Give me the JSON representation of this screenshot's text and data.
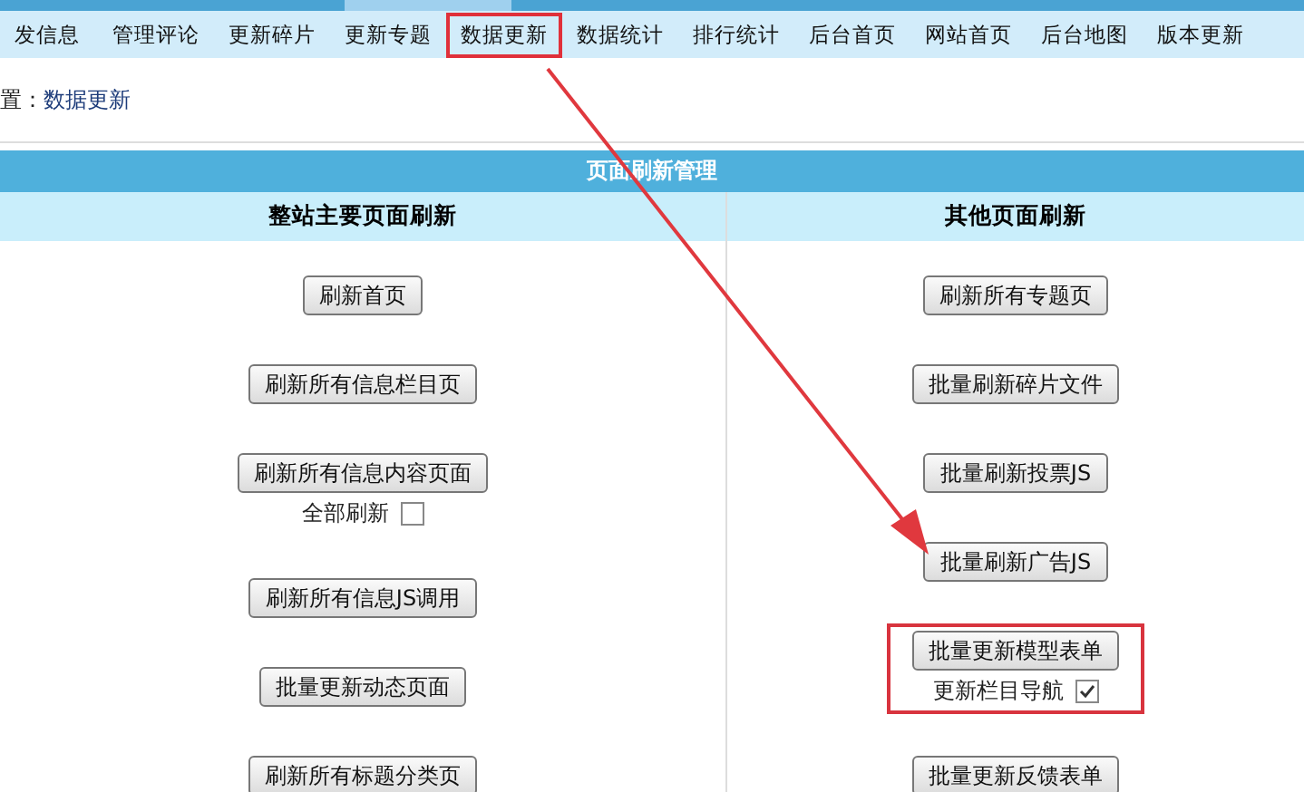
{
  "nav": [
    {
      "label": "发信息",
      "selected": false
    },
    {
      "label": "管理评论",
      "selected": false
    },
    {
      "label": "更新碎片",
      "selected": false
    },
    {
      "label": "更新专题",
      "selected": false
    },
    {
      "label": "数据更新",
      "selected": true
    },
    {
      "label": "数据统计",
      "selected": false
    },
    {
      "label": "排行统计",
      "selected": false
    },
    {
      "label": "后台首页",
      "selected": false
    },
    {
      "label": "网站首页",
      "selected": false
    },
    {
      "label": "后台地图",
      "selected": false
    },
    {
      "label": "版本更新",
      "selected": false
    }
  ],
  "breadcrumb": {
    "prefix": "置：",
    "link": "数据更新"
  },
  "panel": {
    "title": "页面刷新管理",
    "columns": [
      {
        "heading": "整站主要页面刷新",
        "items": [
          {
            "button": "刷新首页",
            "highlighted": false
          },
          {
            "button": "刷新所有信息栏目页",
            "highlighted": false
          },
          {
            "button": "刷新所有信息内容页面",
            "highlighted": false,
            "option": {
              "label": "全部刷新",
              "checked": false
            }
          },
          {
            "button": "刷新所有信息JS调用",
            "highlighted": false
          },
          {
            "button": "批量更新动态页面",
            "highlighted": false
          },
          {
            "button": "刷新所有标题分类页",
            "highlighted": false
          }
        ]
      },
      {
        "heading": "其他页面刷新",
        "items": [
          {
            "button": "刷新所有专题页",
            "highlighted": false
          },
          {
            "button": "批量刷新碎片文件",
            "highlighted": false
          },
          {
            "button": "批量刷新投票JS",
            "highlighted": false
          },
          {
            "button": "批量刷新广告JS",
            "highlighted": false
          },
          {
            "button": "批量更新模型表单",
            "highlighted": true,
            "option": {
              "label": "更新栏目导航",
              "checked": true
            }
          },
          {
            "button": "批量更新反馈表单",
            "highlighted": false
          }
        ]
      }
    ]
  }
}
